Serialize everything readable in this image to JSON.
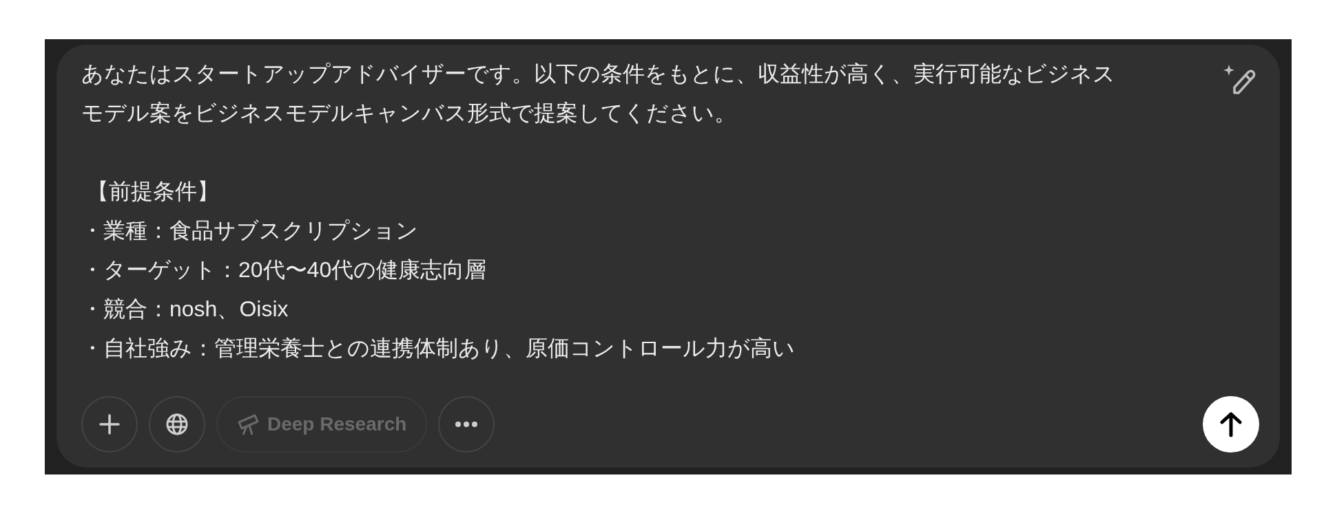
{
  "composer": {
    "blocks": [
      {
        "kind": "paragraph",
        "text": "あなたはスタートアップアドバイザーです。以下の条件をもとに、収益性が高く、実行可能なビジネスモデル案をビジネスモデルキャンバス形式で提案してください。"
      },
      {
        "kind": "heading",
        "text": "【前提条件】"
      },
      {
        "kind": "bullet",
        "text": "・業種：食品サブスクリプション"
      },
      {
        "kind": "bullet",
        "text": "・ターゲット：20代〜40代の健康志向層"
      },
      {
        "kind": "bullet",
        "text": "・競合：nosh、Oisix"
      },
      {
        "kind": "bullet",
        "text": "・自社強み：管理栄養士との連携体制あり、原価コントロール力が高い"
      }
    ],
    "tools": [
      {
        "kind": "circle",
        "disabled": false
      },
      {
        "kind": "circle",
        "disabled": false
      },
      {
        "kind": "pill",
        "label": "Deep Research",
        "disabled": true
      },
      {
        "kind": "circle",
        "disabled": false
      }
    ]
  }
}
